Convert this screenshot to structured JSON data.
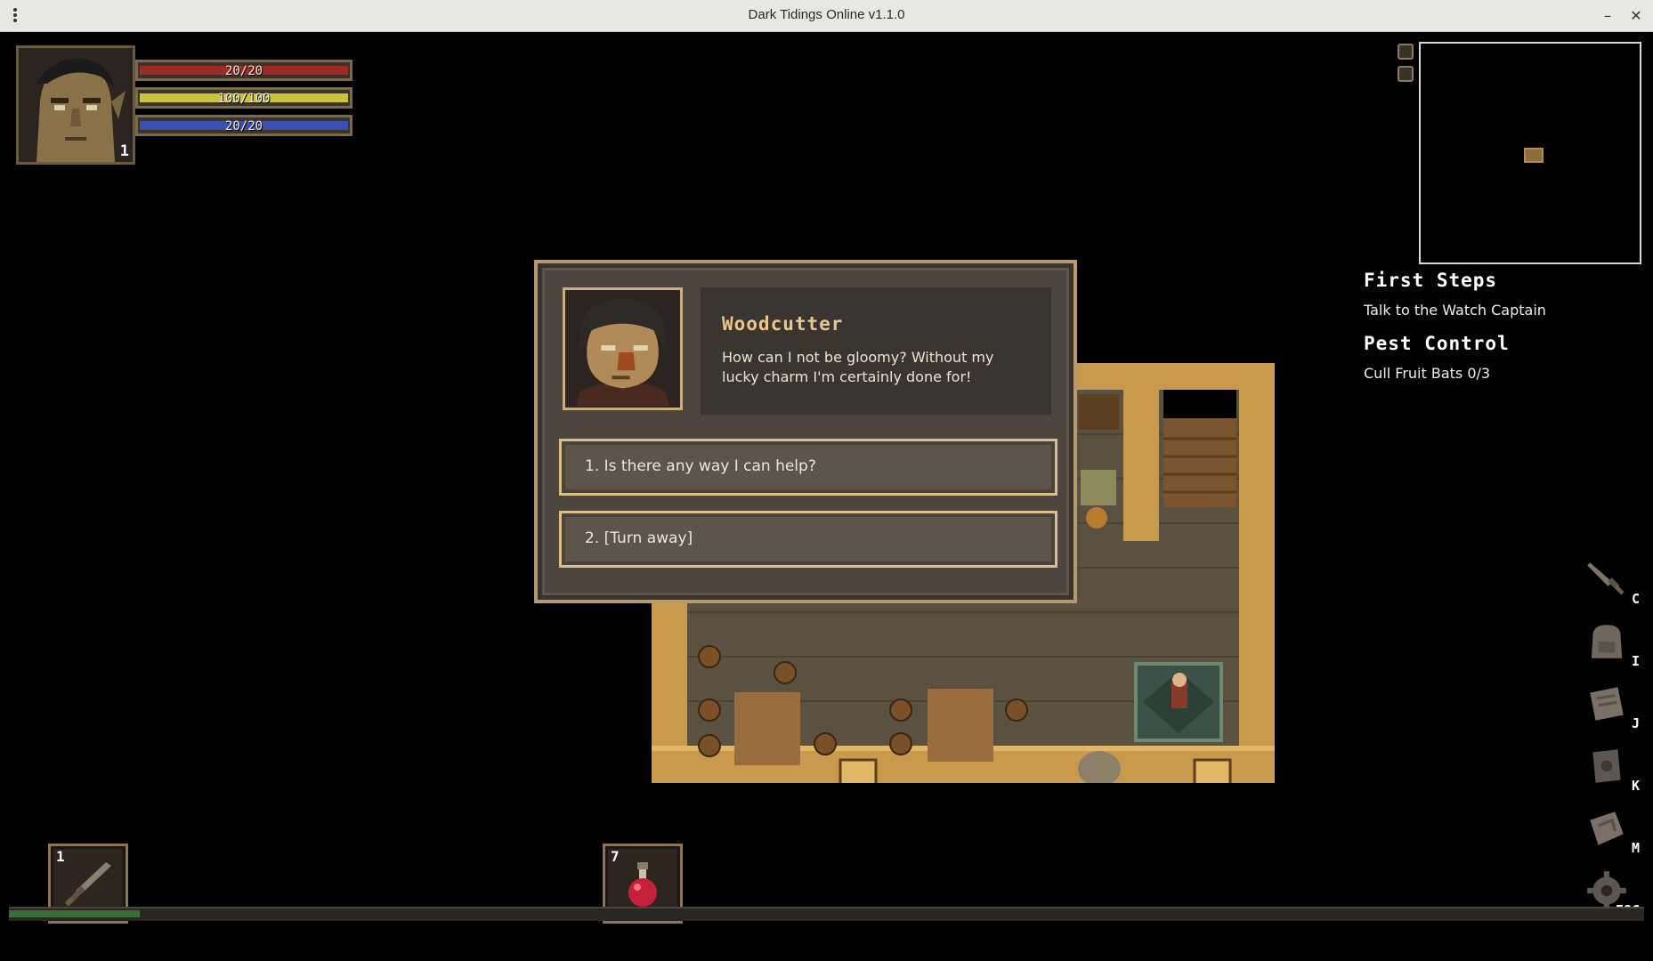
{
  "window": {
    "title": "Dark Tidings Online v1.1.0",
    "minimize_label": "–",
    "close_label": "✕"
  },
  "player": {
    "level": "1",
    "health": {
      "text": "20/20",
      "fraction": 1.0,
      "color": "#9e2a2a"
    },
    "stamina": {
      "text": "100/100",
      "fraction": 1.0,
      "color": "#c9c43a"
    },
    "mana": {
      "text": "20/20",
      "fraction": 1.0,
      "color": "#3a4fb4"
    }
  },
  "quests": [
    {
      "title": "First Steps",
      "objective": "Talk to the Watch Captain"
    },
    {
      "title": "Pest Control",
      "objective": "Cull Fruit Bats 0/3"
    }
  ],
  "dialog": {
    "npc_name": "Woodcutter",
    "npc_text": "How can I not be gloomy? Without my lucky charm I'm certainly done for!",
    "options": [
      {
        "label": "1. Is there any way I can help?"
      },
      {
        "label": "2. [Turn away]"
      }
    ]
  },
  "menu": [
    {
      "icon": "sword-icon",
      "key": "C"
    },
    {
      "icon": "backpack-icon",
      "key": "I"
    },
    {
      "icon": "journal-scroll-icon",
      "key": "J"
    },
    {
      "icon": "skill-book-icon",
      "key": "K"
    },
    {
      "icon": "map-scroll-icon",
      "key": "M"
    },
    {
      "icon": "gear-icon",
      "key": "ESC"
    }
  ],
  "hotbar": [
    {
      "slot": "1",
      "icon": "sword-icon"
    },
    {
      "slot": "7",
      "icon": "health-potion-icon"
    }
  ],
  "experience": {
    "fraction": 0.08,
    "color": "#3b6f3a"
  }
}
